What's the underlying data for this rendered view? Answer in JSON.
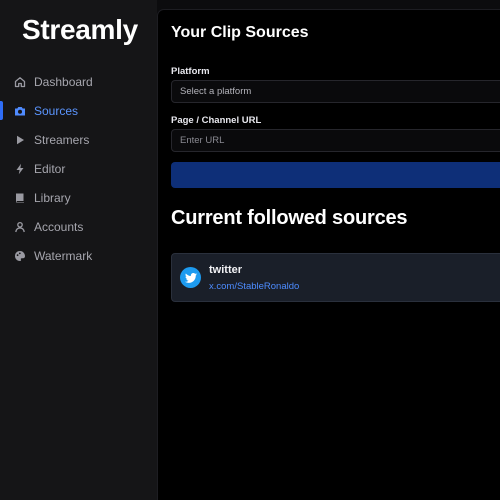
{
  "app": {
    "brand": "Streamly"
  },
  "sidebar": {
    "items": [
      {
        "label": "Dashboard",
        "icon": "home-icon",
        "active": false
      },
      {
        "label": "Sources",
        "icon": "camera-icon",
        "active": true
      },
      {
        "label": "Streamers",
        "icon": "play-icon",
        "active": false
      },
      {
        "label": "Editor",
        "icon": "bolt-icon",
        "active": false
      },
      {
        "label": "Library",
        "icon": "book-icon",
        "active": false
      },
      {
        "label": "Accounts",
        "icon": "user-icon",
        "active": false
      },
      {
        "label": "Watermark",
        "icon": "palette-icon",
        "active": false
      }
    ]
  },
  "main": {
    "title": "Your Clip Sources",
    "form": {
      "platform_label": "Platform",
      "platform_placeholder": "Select a platform",
      "url_label": "Page / Channel URL",
      "url_placeholder": "Enter URL",
      "submit_label": ""
    },
    "followed": {
      "title": "Current followed sources",
      "items": [
        {
          "platform": "twitter",
          "url": "x.com/StableRonaldo",
          "icon": "twitter-icon"
        }
      ]
    }
  },
  "colors": {
    "accent": "#2f6df6",
    "button": "#0e2f78",
    "twitter": "#1d9bf0",
    "link": "#4d8cff"
  }
}
